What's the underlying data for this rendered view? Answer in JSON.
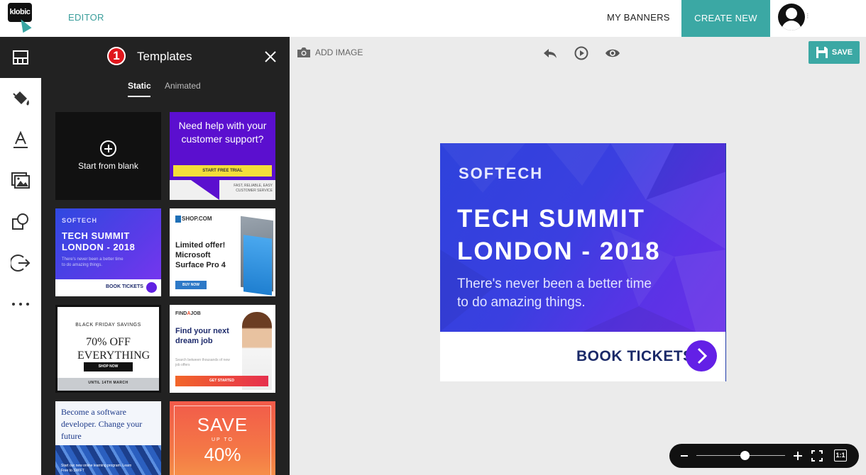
{
  "header": {
    "logo_text": "klobic",
    "nav_editor": "EDITOR",
    "nav_my_banners": "MY BANNERS",
    "create_new": "CREATE NEW"
  },
  "rail": {
    "items": [
      "layout-icon",
      "paint-bucket-icon",
      "text-icon",
      "images-icon",
      "shapes-icon",
      "exit-icon",
      "more-icon"
    ]
  },
  "panel": {
    "badge": "1",
    "title": "Templates",
    "tabs": [
      {
        "label": "Static",
        "active": true
      },
      {
        "label": "Animated",
        "active": false
      }
    ],
    "templates": {
      "blank": "Start from blank",
      "support": {
        "headline": "Need help with your customer support?",
        "button": "START FREE TRIAL",
        "footer": "FAST, RELIABLE, EASY CUSTOMER SERVICE"
      },
      "tech": {
        "brand": "SOFTECH",
        "title": "TECH SUMMIT LONDON - 2018",
        "subtitle": "There's never been a better time to do amazing things.",
        "cta": "BOOK TICKETS"
      },
      "shop": {
        "logo": "SHOP.COM",
        "headline": "Limited offer! Microsoft Surface Pro 4",
        "button": "BUY NOW"
      },
      "blackfriday": {
        "top": "BLACK FRIDAY SAVINGS",
        "big": "70% OFF EVERYTHING",
        "button": "SHOP NOW",
        "footer": "UNTIL 14TH MARCH"
      },
      "job": {
        "logo_a": "FIND",
        "logo_b": "A",
        "logo_c": "JOB",
        "headline": "Find your next dream job",
        "sub": "Search between thousands of new job offers",
        "button": "GET STARTED"
      },
      "software": {
        "headline": "Become a software developer. Change your future",
        "sub": "Start our new online learning program. Learn Free to SWIFT"
      },
      "save": {
        "big": "SAVE",
        "upto": "UP TO",
        "pct": "40%"
      }
    }
  },
  "canvas": {
    "add_image": "ADD IMAGE",
    "save": "SAVE",
    "tools": [
      "undo-icon",
      "play-icon",
      "preview-eye-icon"
    ]
  },
  "banner": {
    "brand": "SOFTECH",
    "title_line1": "TECH SUMMIT",
    "title_line2": "LONDON - 2018",
    "sub_line1": "There's never been a better time",
    "sub_line2": "to do amazing things.",
    "cta": "BOOK TICKETS"
  },
  "zoom": {
    "level": 0.55,
    "one_to_one": "1:1"
  },
  "colors": {
    "accent": "#3ba8a4",
    "panel_bg": "#222222",
    "canvas_bg": "#ebebeb",
    "banner_purple": "#6320e6",
    "banner_navy": "#1b2a69"
  }
}
